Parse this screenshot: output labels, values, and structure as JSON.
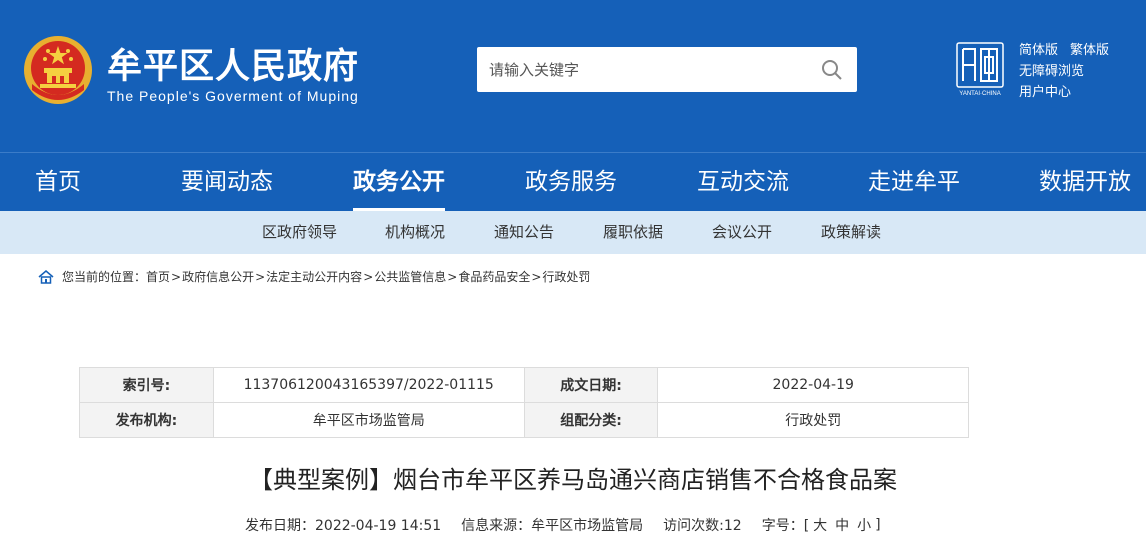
{
  "header": {
    "title": "牟平区人民政府",
    "subtitle": "The People's Goverment of Muping",
    "search_placeholder": "请输入关键字",
    "tools": {
      "simplified": "简体版",
      "traditional": "繁体版",
      "accessible": "无障碍浏览",
      "user_center": "用户中心"
    },
    "colors": {
      "brand_blue": "#1560b8",
      "subnav_bg": "#d8e8f6"
    }
  },
  "nav": {
    "items": [
      "首页",
      "要闻动态",
      "政务公开",
      "政务服务",
      "互动交流",
      "走进牟平",
      "数据开放"
    ],
    "active": "政务公开"
  },
  "subnav": {
    "items": [
      "区政府领导",
      "机构概况",
      "通知公告",
      "履职依据",
      "会议公开",
      "政策解读"
    ]
  },
  "breadcrumb": {
    "prefix": "您当前的位置：",
    "items": [
      "首页",
      "政府信息公开",
      "法定主动公开内容",
      "公共监管信息",
      "食品药品安全",
      "行政处罚"
    ]
  },
  "meta": {
    "index_label": "索引号:",
    "index_value": "113706120043165397/2022-01115",
    "date_label": "成文日期:",
    "date_value": "2022-04-19",
    "org_label": "发布机构:",
    "org_value": "牟平区市场监管局",
    "category_label": "组配分类:",
    "category_value": "行政处罚"
  },
  "article": {
    "title": "【典型案例】烟台市牟平区养马岛通兴商店销售不合格食品案",
    "publish_date": "发布日期：2022-04-19 14:51",
    "source": "信息来源：牟平区市场监管局",
    "visits": "访问次数:12",
    "font_label": "字号：[",
    "font_large": "大",
    "font_medium": "中",
    "font_small": "小",
    "font_end": "]"
  }
}
